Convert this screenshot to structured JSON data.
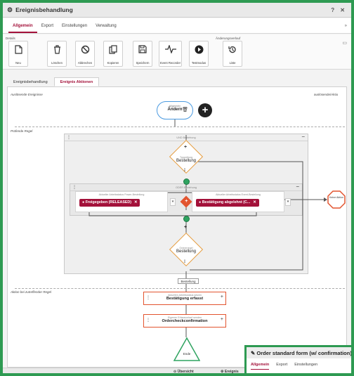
{
  "window": {
    "title": "Ereignisbehandlung",
    "controls": "? ✕"
  },
  "tabs": [
    "Allgemein",
    "Export",
    "Einstellungen",
    "Verwaltung"
  ],
  "tabs_more": "»",
  "ribbon": {
    "group_details": "Details",
    "group_history": "Änderungsverlauf",
    "buttons": [
      {
        "label": "Neu",
        "icon": "new-document-icon"
      },
      {
        "label": "Löschen",
        "icon": "trash-icon"
      },
      {
        "label": "Abbrechen",
        "icon": "cancel-icon"
      },
      {
        "label": "Kopieren",
        "icon": "copy-icon"
      },
      {
        "label": "Speichern",
        "icon": "save-icon"
      },
      {
        "label": "Event Recorder",
        "icon": "pulse-icon"
      },
      {
        "label": "Testmodus",
        "icon": "play-icon"
      },
      {
        "label": "Liste",
        "icon": "history-list-icon"
      }
    ]
  },
  "subtabs": [
    "Ereignisbehandlung",
    "Ereignis Aktionen"
  ],
  "canvas": {
    "trigger_label": "Auslösende Ereignisse",
    "trigger_right_label": "auslösende/Aktio",
    "event_node": {
      "small": "Allgemein",
      "big": "Ändern"
    },
    "rule_label": "Prüfende Regel",
    "and_group": "UND Beziehung",
    "or_group": "ODER Beziehung",
    "decision1": {
      "small": "Typprüfung",
      "big": "Bestellung"
    },
    "criterion_left": {
      "caption": "Aktueller Arbeitsstatus Power-Bestellung",
      "value": "Freigegeben (RELEASED)"
    },
    "criterion_right": {
      "caption": "Aktueller Arbeitsstatus Event-Bestellung",
      "value": "Bestätigung abgelehnt (C..."
    },
    "or_symbol": "+",
    "decision2": {
      "small": "Ordnerregel",
      "big": "Bestellung"
    },
    "stop_node": "Keine Aktion",
    "tag_label": "Bestellung",
    "actions_label": "Aktion bei zutreffender Regel",
    "action1": {
      "small": "Aktuellen Arbeitsstatus setzen",
      "big": "Bestätigung erfasst"
    },
    "action2": {
      "small": "Eigenen Erfassvorlauf senden",
      "big": "Ordercheckconfirmation"
    },
    "end_label": "Ende"
  },
  "bottom_bar": {
    "overview": "Übersicht",
    "event": "Ereignis"
  },
  "popup": {
    "title": "Order standard form (w/ confirmation)",
    "tabs": [
      "Allgemein",
      "Export",
      "Einstellungen"
    ]
  },
  "colors": {
    "accent": "#a3113a",
    "orange": "#e49a3c",
    "red": "#e2542f",
    "green": "#2fa360",
    "blue": "#4a9ae0",
    "frame": "#2e9a52"
  }
}
